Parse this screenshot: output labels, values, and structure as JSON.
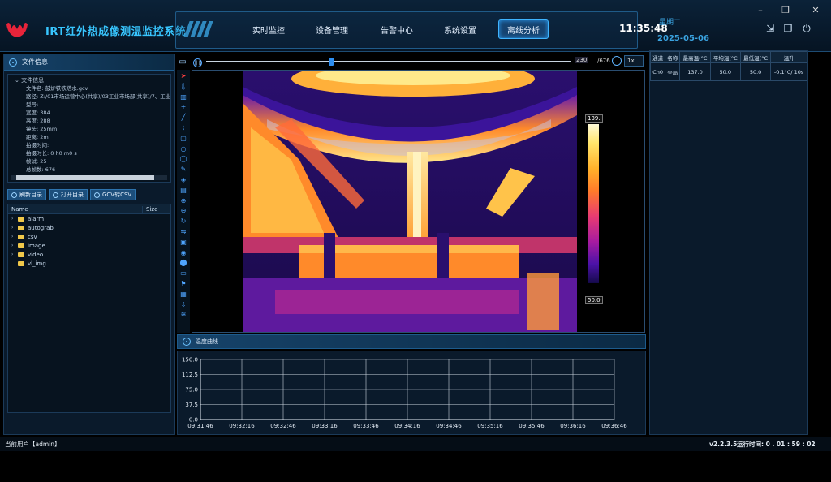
{
  "header": {
    "title": "IRT红外热成像测温监控系统",
    "nav": [
      {
        "label": "实时监控",
        "active": false
      },
      {
        "label": "设备管理",
        "active": false
      },
      {
        "label": "告警中心",
        "active": false
      },
      {
        "label": "系统设置",
        "active": false
      },
      {
        "label": "离线分析",
        "active": true
      }
    ],
    "time": "11:35:48",
    "weekday": "星期二",
    "date": "2025-05-06",
    "icons": [
      "exit-icon",
      "copy-icon",
      "power-icon"
    ],
    "window_controls": [
      "minimize-icon",
      "restore-icon",
      "close-icon"
    ]
  },
  "left_panel": {
    "section_title": "文件信息",
    "info_root": "文件信息",
    "info_lines": [
      "文件名: 鼓炉铁铁塔水.gcv",
      "路径: Z:/01市场运营中心(共享)/03工业市场部(共享)/7、工业加",
      "型号:",
      "宽度: 384",
      "高度: 288",
      "镜头: 25mm",
      "距离: 2m",
      "拍摄时间:",
      "拍摄时长: 0 h0 m0 s",
      "帧试: 25",
      "总帧数: 676"
    ],
    "buttons": [
      "刷新目录",
      "打开目录",
      "GCV转CSV"
    ],
    "tree_header": {
      "name": "Name",
      "size": "Size"
    },
    "tree_items": [
      {
        "label": "alarm",
        "expandable": true
      },
      {
        "label": "autograb",
        "expandable": true
      },
      {
        "label": "csv",
        "expandable": true
      },
      {
        "label": "image",
        "expandable": true
      },
      {
        "label": "video",
        "expandable": true
      },
      {
        "label": "vl_img",
        "expandable": false
      }
    ]
  },
  "player": {
    "frame_current": "230",
    "frame_total": "/676",
    "speed": "1x",
    "progress": 0.34
  },
  "thermal": {
    "max_label": "139.",
    "min_label": "50.0"
  },
  "curve": {
    "title": "温度曲线",
    "chart_data": {
      "type": "line",
      "x": [
        "09:31:46",
        "09:32:16",
        "09:32:46",
        "09:33:16",
        "09:33:46",
        "09:34:16",
        "09:34:46",
        "09:35:16",
        "09:35:46",
        "09:36:16",
        "09:36:46"
      ],
      "series": [],
      "yticks": [
        "150.0",
        "112.5",
        "75.0",
        "37.5",
        "0.0"
      ],
      "ylim": [
        0,
        150
      ],
      "grid": true
    }
  },
  "measure_table": {
    "headers": [
      "通道",
      "名称",
      "最高温(°C",
      "平均温(°C",
      "最低温(°C",
      "温升"
    ],
    "rows": [
      [
        "Ch0",
        "全局",
        "137.0",
        "50.0",
        "50.0",
        "-0.1°C/ 10s"
      ]
    ]
  },
  "status": {
    "user": "当前用户【admin】",
    "version": "v2.2.3.5",
    "runtime": "运行时间: 0 . 01 : 59 : 02"
  }
}
